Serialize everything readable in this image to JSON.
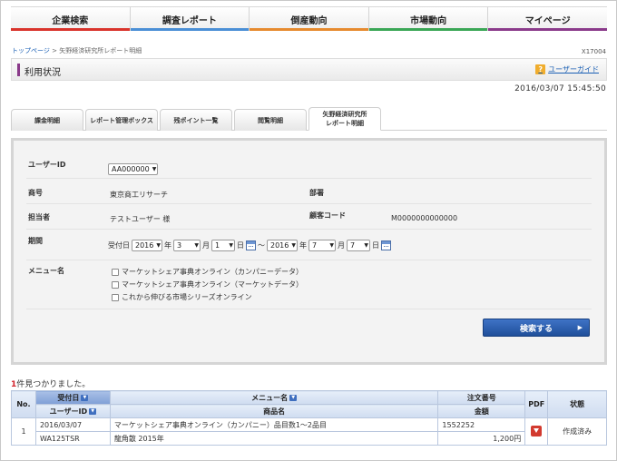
{
  "nav": {
    "items": [
      {
        "label": "企業検索",
        "color": "#d9332b"
      },
      {
        "label": "調査レポート",
        "color": "#4a8fd6"
      },
      {
        "label": "倒産動向",
        "color": "#e68a2e"
      },
      {
        "label": "市場動向",
        "color": "#3aa655"
      },
      {
        "label": "マイページ",
        "color": "#8a3a8a"
      }
    ]
  },
  "breadcrumb": {
    "home": "トップページ",
    "separator": ">",
    "current": "矢野経済研究所レポート明細"
  },
  "page_code": "X17004",
  "header": {
    "title": "利用状況",
    "guide_label": "ユーザーガイド",
    "guide_icon": "question-icon"
  },
  "datetime": "2016/03/07 15:45:50",
  "tabs": [
    {
      "label": "課金明細"
    },
    {
      "label": "レポート管理ボックス"
    },
    {
      "label": "残ポイント一覧"
    },
    {
      "label": "閲覧明細"
    },
    {
      "label": "矢野経済研究所\nレポート明細"
    }
  ],
  "form": {
    "user_id": {
      "label": "ユーザーID",
      "value": "AA000000"
    },
    "company": {
      "label": "商号",
      "value": "東京商工リサーチ"
    },
    "department": {
      "label": "部署",
      "value": ""
    },
    "person": {
      "label": "担当者",
      "value": "テストユーザー 様"
    },
    "customer_code": {
      "label": "顧客コード",
      "value": "M0000000000000"
    },
    "period": {
      "label": "期間",
      "received_label": "受付日",
      "from": {
        "year": "2016",
        "month": "3",
        "day": "1"
      },
      "to": {
        "year": "2016",
        "month": "7",
        "day": "7"
      },
      "year_unit": "年",
      "month_unit": "月",
      "day_unit": "日",
      "range_sep": "〜"
    },
    "menu": {
      "label": "メニュー名",
      "options": [
        "マーケットシェア事典オンライン（カンパニーデータ）",
        "マーケットシェア事典オンライン（マーケットデータ）",
        "これから伸びる市場シリーズオンライン"
      ]
    },
    "search_label": "検索する"
  },
  "results": {
    "count": "1",
    "count_suffix": "件見つかりました。",
    "headers": {
      "no": "No.",
      "received": "受付日",
      "user_id": "ユーザーID",
      "menu": "メニュー名",
      "product": "商品名",
      "order_no": "注文番号",
      "amount": "金額",
      "pdf": "PDF",
      "status": "状態"
    },
    "rows": [
      {
        "no": "1",
        "received": "2016/03/07",
        "user_id": "WA125TSR",
        "menu": "マーケットシェア事典オンライン（カンパニー）品目数1〜2品目",
        "product": "龍角散 2015年",
        "order_no": "1552252",
        "amount": "1,200円",
        "status": "作成済み"
      }
    ]
  }
}
